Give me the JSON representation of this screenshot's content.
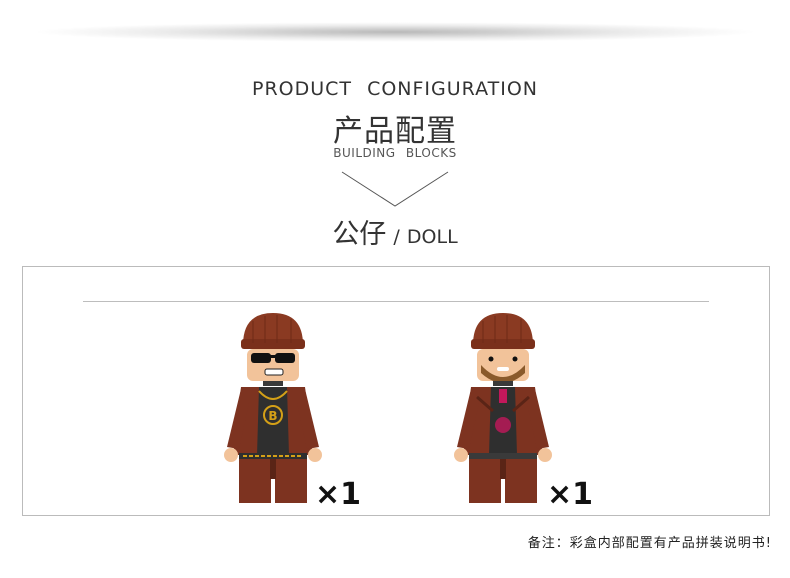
{
  "header": {
    "title_en": "PRODUCT  CONFIGURATION",
    "title_cn": "产品配置",
    "subtitle_en": "BUILDING  BLOCKS"
  },
  "section": {
    "label_cn": "公仔",
    "separator": "/",
    "label_en": "DOLL"
  },
  "figures": [
    {
      "name": "minifigure with sunglasses and B chain necklace",
      "quantity": "×1"
    },
    {
      "name": "bearded minifigure with jacket",
      "quantity": "×1"
    }
  ],
  "footer": {
    "note": "备注：彩盒内部配置有产品拼装说明书!"
  },
  "colors": {
    "hat": "#8a3a22",
    "jacket": "#7d3320",
    "skin": "#f2c39a",
    "shirt": "#3a3a3a"
  }
}
